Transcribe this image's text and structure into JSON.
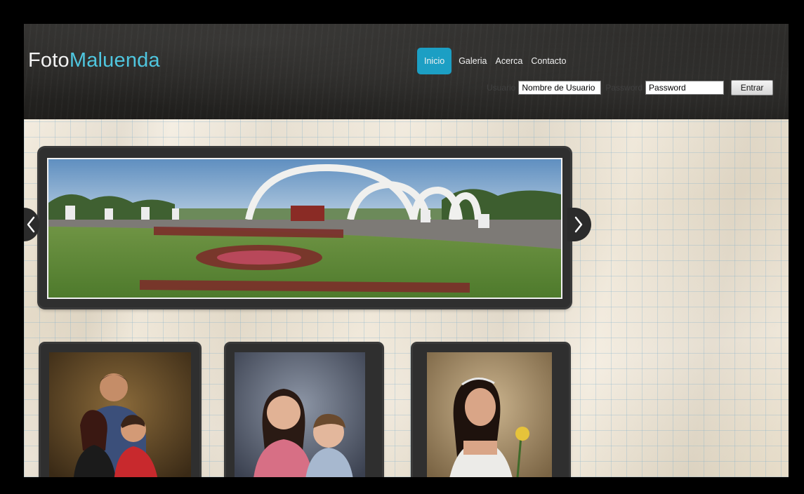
{
  "header": {
    "logo_primary": "Foto",
    "logo_accent": "Maluenda",
    "nav": [
      {
        "label": "Inicio",
        "active": true
      },
      {
        "label": "Galeria",
        "active": false
      },
      {
        "label": "Acerca",
        "active": false
      },
      {
        "label": "Contacto",
        "active": false
      }
    ],
    "login": {
      "user_label": "Usuario",
      "user_value": "Nombre de Usuario",
      "password_label": "Password",
      "password_value": "Password",
      "submit_label": "Entrar"
    }
  },
  "slider": {
    "prev_icon": "chevron-left-icon",
    "next_icon": "chevron-right-icon"
  },
  "thumbnails": [
    {
      "subject": "family-portrait"
    },
    {
      "subject": "children-portrait"
    },
    {
      "subject": "quinceanera-portrait"
    }
  ],
  "colors": {
    "accent": "#4fc6df",
    "nav_active": "#1c9fc4",
    "header_bg": "#2a2927",
    "frame_bg": "#2f2f2f"
  }
}
